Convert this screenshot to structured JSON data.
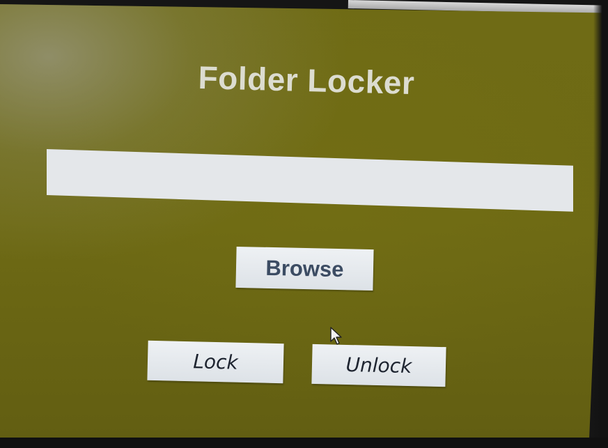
{
  "window": {
    "title": "Folder Locker"
  },
  "path_field": {
    "value": "",
    "placeholder": ""
  },
  "buttons": {
    "browse": "Browse",
    "lock": "Lock",
    "unlock": "Unlock"
  },
  "colors": {
    "window_background": "#6e6a14",
    "title_text": "#dcdcd0",
    "button_face": "#e6e9ed",
    "field_background": "#e4e7ea"
  },
  "icons": {
    "cursor": "mouse-pointer-icon"
  }
}
